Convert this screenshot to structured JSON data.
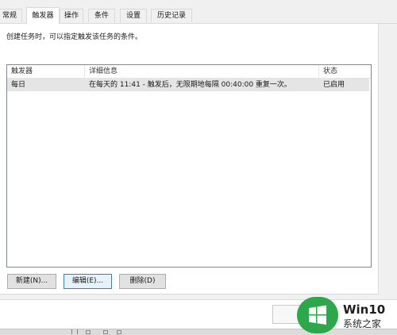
{
  "tabs": [
    {
      "label": "常规",
      "active": false
    },
    {
      "label": "触发器",
      "active": true
    },
    {
      "label": "操作",
      "active": false
    },
    {
      "label": "条件",
      "active": false
    },
    {
      "label": "设置",
      "active": false
    },
    {
      "label": "历史记录",
      "active": false
    }
  ],
  "description": "创建任务时，可以指定触发该任务的条件。",
  "table": {
    "columns": [
      "触发器",
      "详细信息",
      "状态"
    ],
    "rows": [
      {
        "trigger": "每日",
        "details": "在每天的 11:41 - 触发后，无限期地每隔 00:40:00 重复一次。",
        "status": "已启用",
        "selected": true
      }
    ]
  },
  "buttons": {
    "new": "新建(N)...",
    "edit": "编辑(E)...",
    "delete": "删除(D)"
  },
  "watermark": {
    "line1": "Win10",
    "line2": "系统之家"
  },
  "colors": {
    "selected_row": "#e5e5e5",
    "logo_green": "#2aa84a",
    "focus_border": "#3c7fb1"
  }
}
